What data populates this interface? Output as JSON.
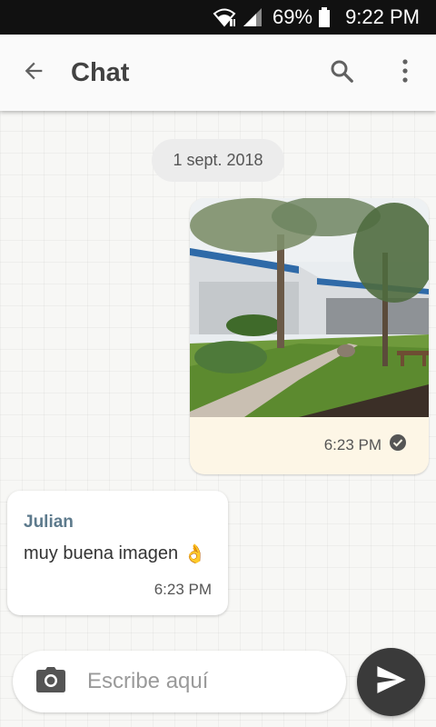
{
  "status_bar": {
    "battery_percent": "69%",
    "time": "9:22 PM",
    "icons": [
      "wifi-icon",
      "signal-icon",
      "battery-icon"
    ]
  },
  "app_bar": {
    "title": "Chat",
    "icons": [
      "back-arrow-icon",
      "search-icon",
      "more-vert-icon"
    ]
  },
  "conversation": {
    "date_chip": "1 sept. 2018",
    "outgoing": {
      "type": "image",
      "time": "6:23 PM",
      "status_icon": "delivered-check-icon"
    },
    "incoming": {
      "sender": "Julian",
      "text": "muy buena imagen",
      "emoji": "👌",
      "time": "6:23 PM"
    }
  },
  "composer": {
    "placeholder": "Escribe aquí",
    "value": "",
    "icons": [
      "camera-icon",
      "send-icon"
    ]
  },
  "colors": {
    "status_bar": "#111111",
    "outgoing_bubble": "#fdf6e6",
    "sender_name": "#5d7a8c",
    "send_button": "#3a3a3a"
  }
}
